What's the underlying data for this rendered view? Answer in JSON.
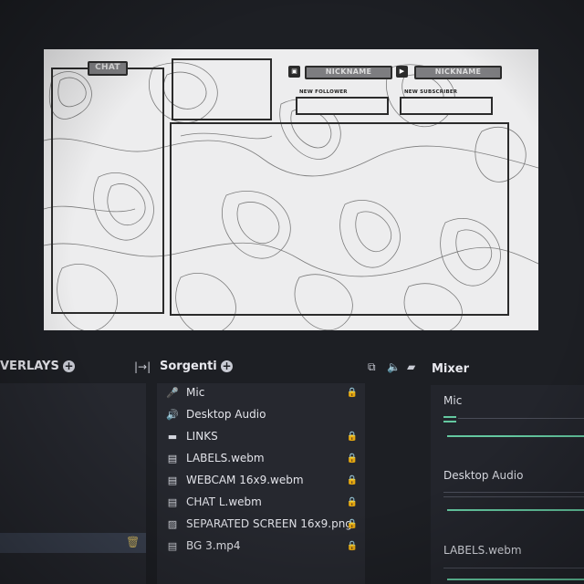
{
  "preview": {
    "chat_label": "CHAT",
    "nickname_twitch": "NICKNAME",
    "nickname_youtube": "NICKNAME",
    "new_follower": "NEW FOLLOWER",
    "new_subscriber": "NEW SUBSCRIBER"
  },
  "scenes": {
    "title": "VERLAYS"
  },
  "sources": {
    "title": "Sorgenti",
    "items": [
      {
        "label": "Mic",
        "icon": "microphone-icon",
        "locked": true
      },
      {
        "label": "Desktop Audio",
        "icon": "speaker-icon",
        "locked": false
      },
      {
        "label": "LINKS",
        "icon": "folder-icon",
        "locked": true
      },
      {
        "label": "LABELS.webm",
        "icon": "file-icon",
        "locked": true
      },
      {
        "label": "WEBCAM 16x9.webm",
        "icon": "file-icon",
        "locked": true
      },
      {
        "label": "CHAT L.webm",
        "icon": "file-icon",
        "locked": true
      },
      {
        "label": "SEPARATED SCREEN 16x9.png",
        "icon": "image-icon",
        "locked": true
      },
      {
        "label": "BG 3.mp4",
        "icon": "file-icon",
        "locked": true
      }
    ]
  },
  "mixer": {
    "title": "Mixer",
    "channels": [
      "Mic",
      "Desktop Audio",
      "LABELS.webm"
    ]
  },
  "colors": {
    "accent": "#64c8a0",
    "panel": "#26282f",
    "background": "#1d1f24"
  }
}
